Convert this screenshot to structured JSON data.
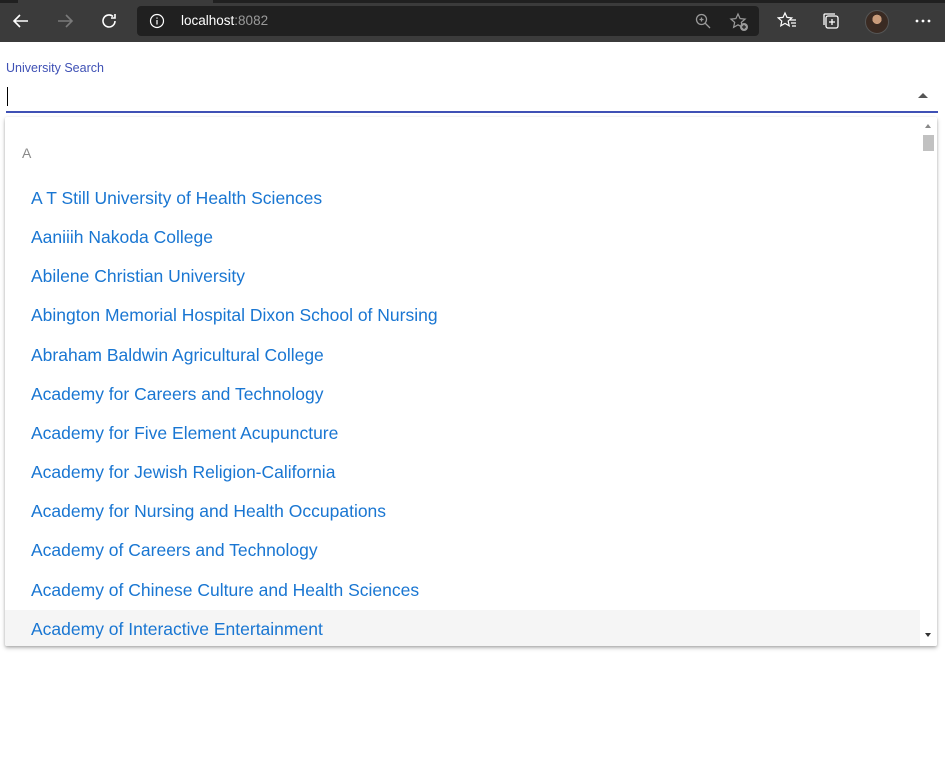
{
  "browser": {
    "url_host": "localhost",
    "url_port": ":8082",
    "icons": {
      "back": "back-arrow-icon",
      "forward": "forward-arrow-icon",
      "refresh": "refresh-icon",
      "info": "info-icon",
      "zoom": "zoom-icon",
      "add_favorite": "add-favorite-icon",
      "favorites": "favorites-icon",
      "collections": "collections-icon",
      "more": "more-icon"
    }
  },
  "search": {
    "label": "University Search",
    "value": "",
    "accent_color": "#3f51b5"
  },
  "listbox": {
    "group_header": "A",
    "options": [
      "A T Still University of Health Sciences",
      "Aaniiih Nakoda College",
      "Abilene Christian University",
      "Abington Memorial Hospital Dixon School of Nursing",
      "Abraham Baldwin Agricultural College",
      "Academy for Careers and Technology",
      "Academy for Five Element Acupuncture",
      "Academy for Jewish Religion-California",
      "Academy for Nursing and Health Occupations",
      "Academy of Careers and Technology",
      "Academy of Chinese Culture and Health Sciences",
      "Academy of Interactive Entertainment"
    ],
    "option_color": "#1976d2",
    "highlighted_index": 11
  }
}
